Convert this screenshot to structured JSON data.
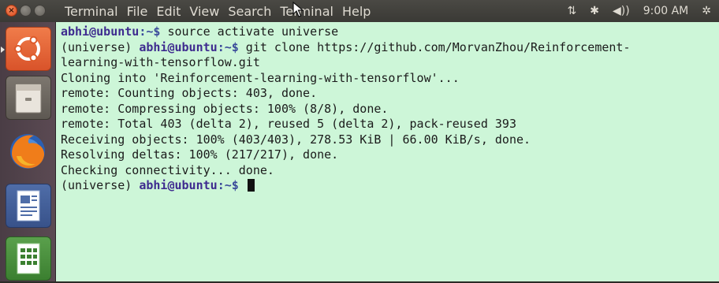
{
  "window": {
    "close_glyph": "×",
    "min_glyph": "–",
    "max_glyph": "□"
  },
  "menubar": {
    "items": [
      "Terminal",
      "File",
      "Edit",
      "View",
      "Search",
      "Terminal",
      "Help"
    ]
  },
  "indicators": {
    "network": "⇅",
    "bluetooth": "✱",
    "volume": "◀))",
    "time": "9:00 AM",
    "settings": "✲"
  },
  "launcher": {
    "items": [
      {
        "name": "dash-home",
        "icon": "ubuntu-logo-icon"
      },
      {
        "name": "files",
        "icon": "file-cabinet-icon"
      },
      {
        "name": "firefox",
        "icon": "firefox-icon"
      },
      {
        "name": "libreoffice-writer",
        "icon": "document-icon"
      },
      {
        "name": "libreoffice-calc",
        "icon": "spreadsheet-icon"
      }
    ]
  },
  "terminal": {
    "lines": [
      {
        "env": "",
        "user": "abhi@ubuntu",
        "path": ":~$",
        "text": " source activate universe"
      },
      {
        "env": "(universe) ",
        "user": "abhi@ubuntu",
        "path": ":~$",
        "text": " git clone https://github.com/MorvanZhou/Reinforcement-"
      },
      {
        "text": "learning-with-tensorflow.git"
      },
      {
        "text": "Cloning into 'Reinforcement-learning-with-tensorflow'..."
      },
      {
        "text": "remote: Counting objects: 403, done."
      },
      {
        "text": "remote: Compressing objects: 100% (8/8), done."
      },
      {
        "text": "remote: Total 403 (delta 2), reused 5 (delta 2), pack-reused 393"
      },
      {
        "text": "Receiving objects: 100% (403/403), 278.53 KiB | 66.00 KiB/s, done."
      },
      {
        "text": "Resolving deltas: 100% (217/217), done."
      },
      {
        "text": "Checking connectivity... done."
      },
      {
        "env": "(universe) ",
        "user": "abhi@ubuntu",
        "path": ":~$",
        "text": " ",
        "cursor": true
      }
    ]
  }
}
